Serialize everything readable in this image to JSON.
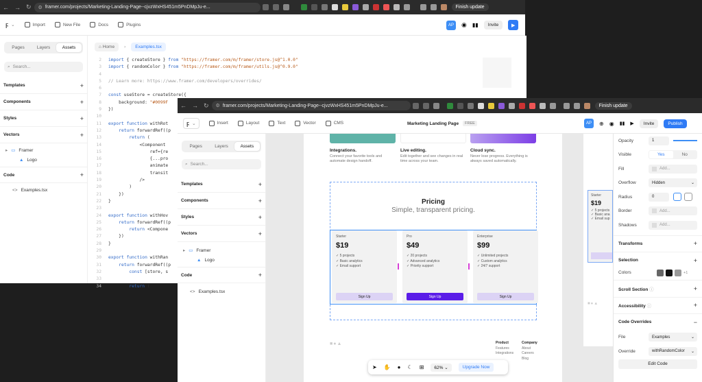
{
  "browser_back": {
    "url": "framer.com/projects/Marketing-Landing-Page--cjvzWxHS451m5PnDMpJu-e...",
    "finish": "Finish update"
  },
  "browser_front": {
    "url": "framer.com/projects/Marketing-Landing-Page--cjvzWxHS451m5PnDMpJu-e...",
    "finish": "Finish update"
  },
  "back_toolbar": {
    "items": [
      "Import",
      "New File",
      "Docs",
      "Plugins"
    ],
    "avatar": "AP",
    "invite": "Invite"
  },
  "front_toolbar": {
    "items": [
      "Insert",
      "Layout",
      "Text",
      "Vector",
      "CMS"
    ],
    "project_title": "Marketing Landing Page",
    "plan_badge": "FREE",
    "avatar": "AP",
    "invite": "Invite",
    "publish": "Publish"
  },
  "back_sidebar": {
    "tabs": [
      "Pages",
      "Layers",
      "Assets"
    ],
    "search_placeholder": "Search...",
    "sections": [
      "Templates",
      "Components",
      "Styles",
      "Vectors"
    ],
    "tree": [
      "Framer",
      "Logo"
    ],
    "code_section": "Code",
    "code_file": "Examples.tsx"
  },
  "front_sidebar": {
    "tabs": [
      "Pages",
      "Layers",
      "Assets"
    ],
    "search_placeholder": "Search...",
    "sections": [
      "Templates",
      "Components",
      "Styles",
      "Vectors"
    ],
    "tree": [
      "Framer",
      "Logo"
    ],
    "code_section": "Code",
    "code_file": "Examples.tsx"
  },
  "breadcrumb": {
    "home": "Home",
    "file": "Examples.tsx"
  },
  "code_lines": [
    {
      "n": "2",
      "text": "import { createStore } from \"https://framer.com/m/framer/store.js@^1.0.0\""
    },
    {
      "n": "3",
      "text": "import { randomColor } from \"https://framer.com/m/framer/utils.js@^0.9.0\""
    },
    {
      "n": "4",
      "text": ""
    },
    {
      "n": "5",
      "text": "// Learn more: https://www.framer.com/developers/overrides/"
    },
    {
      "n": "6",
      "text": ""
    },
    {
      "n": "7",
      "text": "const useStore = createStore({"
    },
    {
      "n": "8",
      "text": "    background: \"#0099F"
    },
    {
      "n": "9",
      "text": "})"
    },
    {
      "n": "10",
      "text": ""
    },
    {
      "n": "11",
      "text": "export function withRot"
    },
    {
      "n": "12",
      "text": "    return forwardRef((p"
    },
    {
      "n": "13",
      "text": "        return ("
    },
    {
      "n": "14",
      "text": "            <Component"
    },
    {
      "n": "15",
      "text": "                ref={re"
    },
    {
      "n": "16",
      "text": "                {...pro"
    },
    {
      "n": "17",
      "text": "                animate"
    },
    {
      "n": "18",
      "text": "                transit"
    },
    {
      "n": "19",
      "text": "            />"
    },
    {
      "n": "20",
      "text": "        )"
    },
    {
      "n": "21",
      "text": "    })"
    },
    {
      "n": "22",
      "text": "}"
    },
    {
      "n": "23",
      "text": ""
    },
    {
      "n": "24",
      "text": "export function withHov"
    },
    {
      "n": "25",
      "text": "    return forwardRef((p"
    },
    {
      "n": "26",
      "text": "        return <Compone"
    },
    {
      "n": "27",
      "text": "    })"
    },
    {
      "n": "28",
      "text": "}"
    },
    {
      "n": "29",
      "text": ""
    },
    {
      "n": "30",
      "text": "export function withRan"
    },
    {
      "n": "31",
      "text": "    return forwardRef((p"
    },
    {
      "n": "32",
      "text": "        const [store, s"
    },
    {
      "n": "33",
      "text": ""
    },
    {
      "n": "34",
      "text": "        return ("
    }
  ],
  "features": [
    {
      "title": "Integrations.",
      "desc": "Connect your favorite tools and automate design handoff."
    },
    {
      "title": "Live editing.",
      "desc": "Edit together and see changes in real time across your team."
    },
    {
      "title": "Cloud sync.",
      "desc": "Never lose progress. Everything is always saved automatically."
    }
  ],
  "pricing": {
    "title": "Pricing",
    "subtitle": "Simple, transparent pricing.",
    "plans": [
      {
        "name": "Starter",
        "price": "$19",
        "items": [
          "5 projects",
          "Basic analytics",
          "Email support"
        ],
        "cta": "Sign Up"
      },
      {
        "name": "Pro",
        "price": "$49",
        "items": [
          "20 projects",
          "Advanced analytics",
          "Priority support"
        ],
        "cta": "Sign Up"
      },
      {
        "name": "Enterprise",
        "price": "$99",
        "items": [
          "Unlimited projects",
          "Custom analytics",
          "24/7 support"
        ],
        "cta": "Sign Up"
      }
    ]
  },
  "footer": {
    "col1": {
      "title": "Product",
      "links": [
        "Features",
        "Integrations"
      ]
    },
    "col2": {
      "title": "Company",
      "links": [
        "About",
        "Careers",
        "Blog"
      ]
    }
  },
  "side_preview": {
    "name": "Starter",
    "price": "$19",
    "items": [
      "5 projects",
      "Basic ana",
      "Email sup"
    ]
  },
  "properties": {
    "opacity_label": "Opacity",
    "opacity_value": "1",
    "visible_label": "Visible",
    "visible_yes": "Yes",
    "visible_no": "No",
    "fill_label": "Fill",
    "fill_value": "Add...",
    "overflow_label": "Overflow",
    "overflow_value": "Hidden",
    "radius_label": "Radius",
    "radius_value": "0",
    "border_label": "Border",
    "border_value": "Add...",
    "shadows_label": "Shadows",
    "shadows_value": "Add...",
    "transforms": "Transforms",
    "selection": "Selection",
    "colors_label": "Colors",
    "colors_more": "+1",
    "scroll_section": "Scroll Section",
    "accessibility": "Accessibility",
    "code_overrides": "Code Overrides",
    "file_label": "File",
    "file_value": "Examples",
    "override_label": "Override",
    "override_value": "withRandomColor",
    "edit_code": "Edit Code"
  },
  "bottom_bar": {
    "zoom": "62%",
    "upgrade": "Upgrade Now"
  },
  "colors": {
    "accent": "#2f7bf5",
    "purple": "#5b1de8",
    "teal": "#5fb3a8",
    "lavender": "#dcd3f5"
  }
}
